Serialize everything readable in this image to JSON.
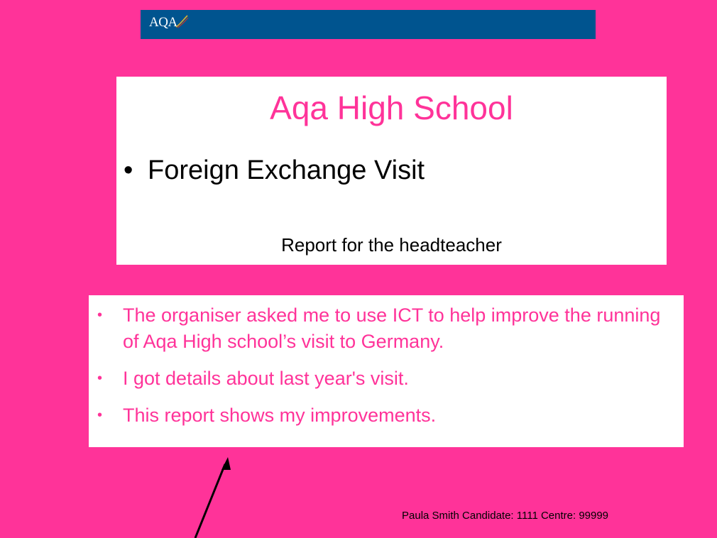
{
  "header": {
    "logo_text": "AQA"
  },
  "title_slide": {
    "title": "Aqa High School",
    "bullet": "•",
    "subtitle": "Foreign Exchange Visit",
    "report_line": "Report for the headteacher"
  },
  "info": {
    "bullet": "•",
    "items": [
      "The organiser asked me to use ICT to help improve the running of Aqa High school’s visit to Germany.",
      "I got details about last year's visit.",
      "This report shows my improvements."
    ]
  },
  "footer": {
    "text": "Paula Smith Candidate: 1111 Centre: 99999"
  },
  "colors": {
    "background": "#ff3399",
    "accent_pink": "#ff3399",
    "logo_blue": "#00548f",
    "box_white": "#ffffff"
  }
}
